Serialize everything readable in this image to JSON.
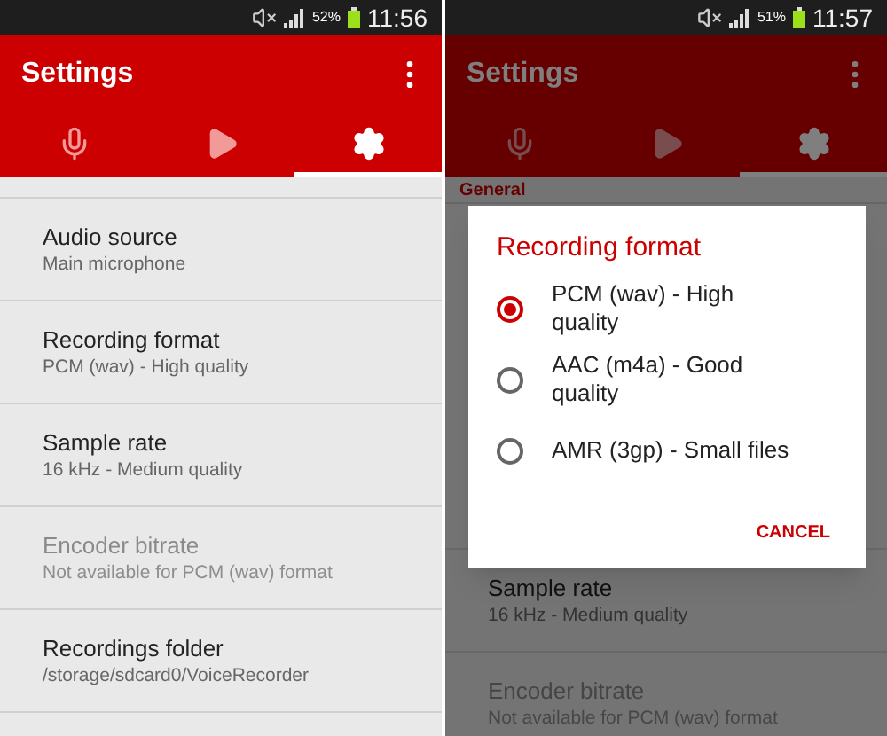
{
  "screens": [
    {
      "status_bar": {
        "battery": "52%",
        "time": "11:56"
      },
      "app_bar": {
        "title": "Settings"
      },
      "tabs": [
        {
          "kind": "mic",
          "selected": false
        },
        {
          "kind": "play",
          "selected": false
        },
        {
          "kind": "settings",
          "selected": true
        }
      ],
      "settings": [
        {
          "title": "Audio source",
          "summary": "Main microphone",
          "disabled": false
        },
        {
          "title": "Recording format",
          "summary": "PCM (wav) - High quality",
          "disabled": false
        },
        {
          "title": "Sample rate",
          "summary": "16 kHz - Medium quality",
          "disabled": false
        },
        {
          "title": "Encoder bitrate",
          "summary": "Not available for PCM (wav) format",
          "disabled": true
        },
        {
          "title": "Recordings folder",
          "summary": "/storage/sdcard0/VoiceRecorder",
          "disabled": false
        }
      ]
    },
    {
      "status_bar": {
        "battery": "51%",
        "time": "11:57"
      },
      "app_bar": {
        "title": "Settings"
      },
      "tabs": [
        {
          "kind": "mic",
          "selected": false
        },
        {
          "kind": "play",
          "selected": false
        },
        {
          "kind": "settings",
          "selected": true
        }
      ],
      "section_header": "General",
      "settings": [
        {
          "title": "Sample rate",
          "summary": "16 kHz - Medium quality",
          "disabled": false
        },
        {
          "title": "Encoder bitrate",
          "summary": "Not available for PCM (wav) format",
          "disabled": true
        }
      ],
      "dialog": {
        "title": "Recording format",
        "options": [
          {
            "label": "PCM (wav) - High quality",
            "selected": true
          },
          {
            "label": "AAC (m4a) - Good quality",
            "selected": false
          },
          {
            "label": "AMR (3gp) - Small files",
            "selected": false
          }
        ],
        "button": "CANCEL"
      }
    }
  ]
}
